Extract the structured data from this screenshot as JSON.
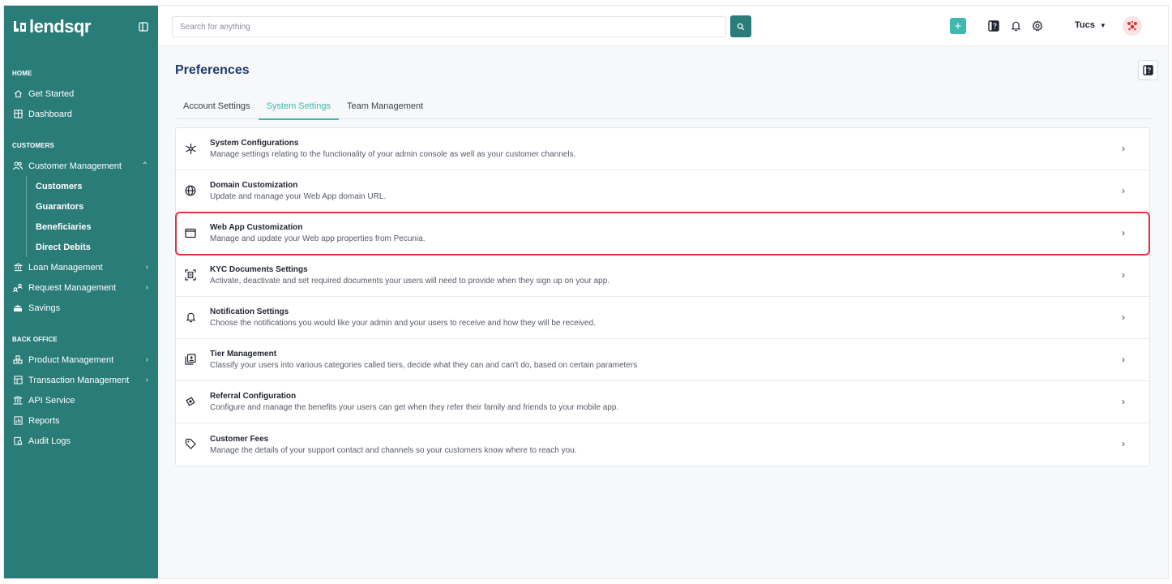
{
  "brand": {
    "name": "lendsqr",
    "mark": "ᒪᒧ"
  },
  "sidebar": {
    "sections": [
      {
        "label": "HOME"
      },
      {
        "label": "CUSTOMERS"
      },
      {
        "label": "BACK OFFICE"
      }
    ],
    "home_items": [
      {
        "label": "Get Started"
      },
      {
        "label": "Dashboard"
      }
    ],
    "customer_items": [
      {
        "label": "Customer Management"
      },
      {
        "label": "Loan Management"
      },
      {
        "label": "Request Management"
      },
      {
        "label": "Savings"
      }
    ],
    "customer_sub_items": [
      {
        "label": "Customers"
      },
      {
        "label": "Guarantors"
      },
      {
        "label": "Beneficiaries"
      },
      {
        "label": "Direct Debits"
      }
    ],
    "back_office_items": [
      {
        "label": "Product Management"
      },
      {
        "label": "Transaction Management"
      },
      {
        "label": "API Service"
      },
      {
        "label": "Reports"
      },
      {
        "label": "Audit Logs"
      }
    ]
  },
  "header": {
    "search_placeholder": "Search for anything",
    "plus_label": "+",
    "user_name": "Tucs"
  },
  "page": {
    "title": "Preferences",
    "tabs": [
      {
        "label": "Account Settings"
      },
      {
        "label": "System Settings"
      },
      {
        "label": "Team Management"
      }
    ],
    "active_tab": "System Settings",
    "settings": [
      {
        "title": "System Configurations",
        "desc": "Manage settings relating to the functionality of your admin console as well as your customer channels.",
        "icon": "network-icon"
      },
      {
        "title": "Domain Customization",
        "desc": "Update and manage your Web App domain URL.",
        "icon": "globe-icon"
      },
      {
        "title": "Web App Customization",
        "desc": "Manage and update your Web app properties from Pecunia.",
        "icon": "window-icon",
        "highlighted": true
      },
      {
        "title": "KYC Documents Settings",
        "desc": "Activate, deactivate and set required documents your users will need to provide when they sign up on your app.",
        "icon": "document-scan-icon"
      },
      {
        "title": "Notification Settings",
        "desc": "Choose the notifications you would like your admin and your users to receive and how they will be received.",
        "icon": "bell-icon"
      },
      {
        "title": "Tier Management",
        "desc": "Classify your users into various categories called tiers, decide what they can and can't do, based on certain parameters",
        "icon": "layers-icon"
      },
      {
        "title": "Referral Configuration",
        "desc": "Configure and manage the benefits your users can get when they refer their family and friends to your mobile app.",
        "icon": "referral-icon"
      },
      {
        "title": "Customer Fees",
        "desc": "Manage the details of your support contact and channels so your customers know where to reach you.",
        "icon": "tag-icon"
      }
    ]
  },
  "colors": {
    "sidebar": "#2a7c79",
    "accent": "#3fb8ad",
    "title": "#1e3a6d",
    "highlight": "#e0353b"
  }
}
